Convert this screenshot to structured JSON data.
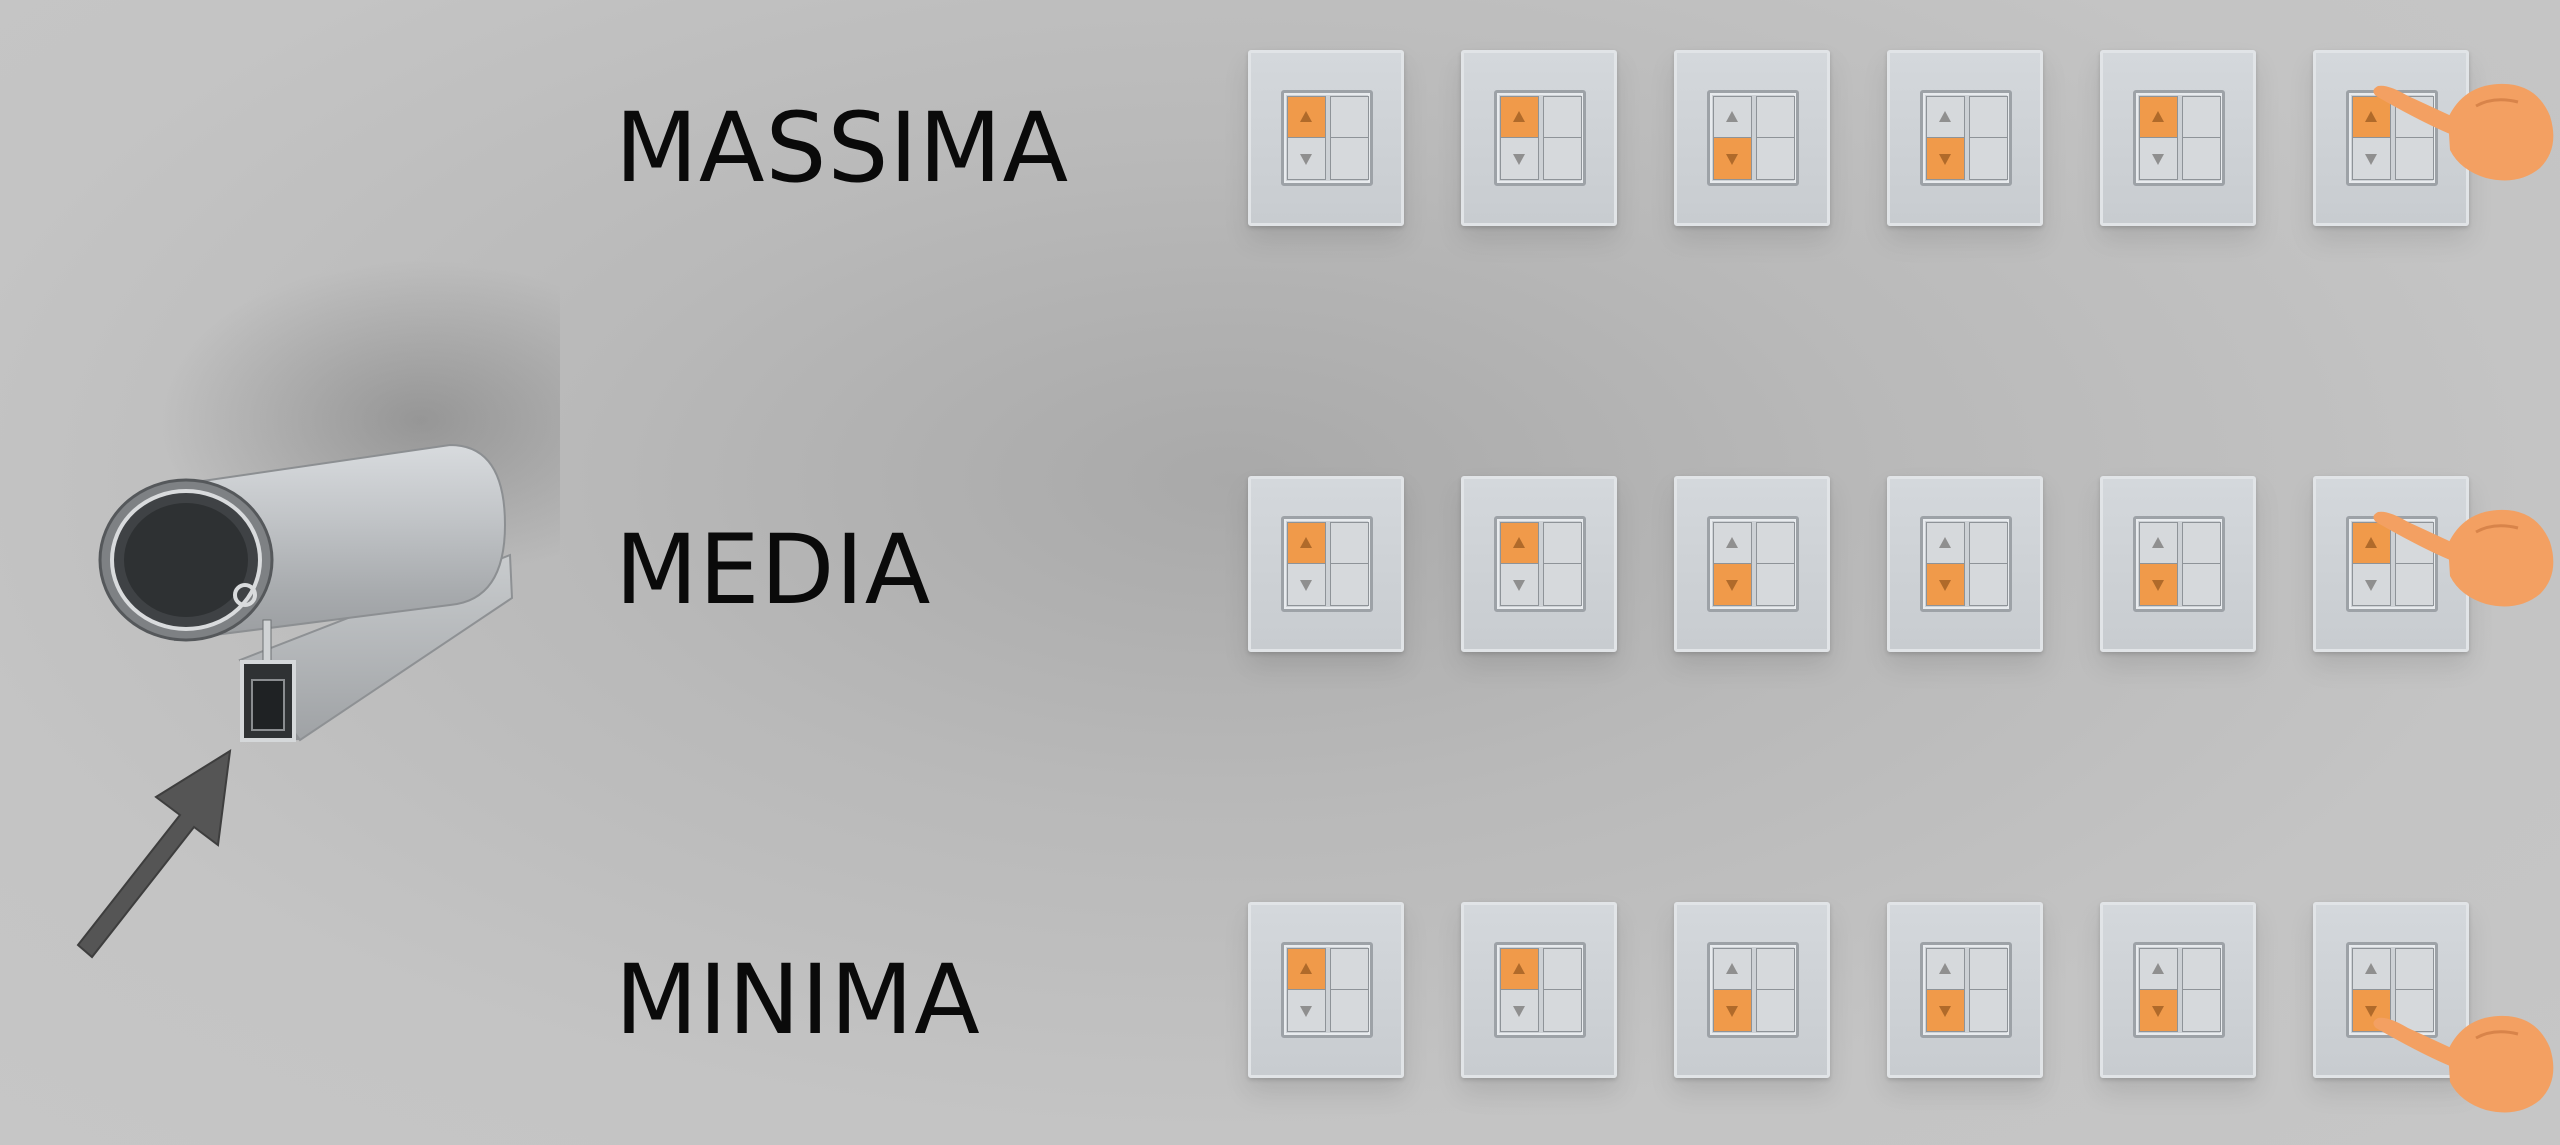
{
  "levels": [
    {
      "label": "MASSIMA",
      "switches": [
        {
          "active": "up"
        },
        {
          "active": "up"
        },
        {
          "active": "down"
        },
        {
          "active": "down"
        },
        {
          "active": "up"
        },
        {
          "active": "up",
          "hand": true
        }
      ]
    },
    {
      "label": "MEDIA",
      "switches": [
        {
          "active": "up"
        },
        {
          "active": "up"
        },
        {
          "active": "down"
        },
        {
          "active": "down"
        },
        {
          "active": "down"
        },
        {
          "active": "up",
          "hand": true
        }
      ]
    },
    {
      "label": "MINIMA",
      "switches": [
        {
          "active": "up"
        },
        {
          "active": "up"
        },
        {
          "active": "down"
        },
        {
          "active": "down"
        },
        {
          "active": "down"
        },
        {
          "active": "down",
          "hand": true
        }
      ]
    }
  ],
  "colors": {
    "background": "#c4c4c4",
    "active_button": "#f09a4a",
    "hand": "#f3a062",
    "label_text": "#0a0a0a",
    "arrow": "#555555",
    "profile_metal": "#b5b8bb"
  },
  "icons": [
    "aluminium-roller-profile-icon",
    "pointer-arrow-icon",
    "pointing-hand-icon",
    "arrow-up-icon",
    "arrow-down-icon"
  ]
}
